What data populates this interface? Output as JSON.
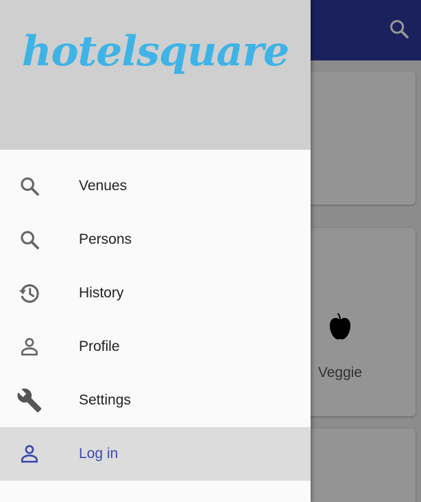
{
  "app": {
    "colors": {
      "app_bar": "#303aa0",
      "accent": "#3fb3e6",
      "active_label": "#3b4ab3"
    },
    "veggie_label": "Veggie"
  },
  "drawer": {
    "logo_text": "hotelsquare",
    "items": [
      {
        "label": "Venues",
        "icon": "search-icon",
        "active": false
      },
      {
        "label": "Persons",
        "icon": "search-icon",
        "active": false
      },
      {
        "label": "History",
        "icon": "history-icon",
        "active": false
      },
      {
        "label": "Profile",
        "icon": "person-icon",
        "active": false
      },
      {
        "label": "Settings",
        "icon": "wrench-icon",
        "active": false
      },
      {
        "label": "Log in",
        "icon": "person-icon",
        "active": true
      }
    ]
  }
}
